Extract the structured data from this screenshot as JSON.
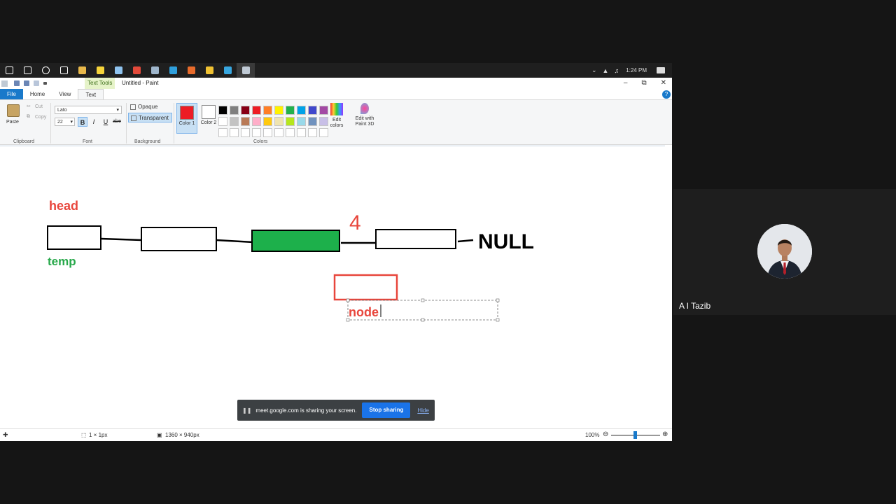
{
  "taskbar": {
    "icons": [
      {
        "name": "start-icon",
        "color": "#ffffff"
      },
      {
        "name": "search-icon",
        "color": "#ffffff"
      },
      {
        "name": "cortana-icon",
        "color": "#ffffff"
      },
      {
        "name": "task-view-icon",
        "color": "#ffffff"
      },
      {
        "name": "file-explorer-icon",
        "color": "#e8b84a"
      },
      {
        "name": "sticky-notes-icon",
        "color": "#f6d43a"
      },
      {
        "name": "notepad-icon",
        "color": "#8fc3ef"
      },
      {
        "name": "chrome-icon",
        "color": "#e3493a"
      },
      {
        "name": "document-icon",
        "color": "#9fb6cc"
      },
      {
        "name": "edge-icon",
        "color": "#2f9fdc"
      },
      {
        "name": "office-icon",
        "color": "#e86b2b"
      },
      {
        "name": "chrome-2-icon",
        "color": "#f1c232"
      },
      {
        "name": "edge-2-icon",
        "color": "#38a7e0"
      },
      {
        "name": "paint-icon",
        "color": "#bfc9d4"
      }
    ],
    "clock": "1:24 PM"
  },
  "titlebar": {
    "context_tab": "Text Tools",
    "title": "Untitled - Paint"
  },
  "tabs": {
    "file": "File",
    "home": "Home",
    "view": "View",
    "text": "Text"
  },
  "ribbon": {
    "clipboard": {
      "paste": "Paste",
      "cut": "Cut",
      "copy": "Copy",
      "label": "Clipboard"
    },
    "font": {
      "family": "Lato",
      "size": "22",
      "bold": "B",
      "italic": "I",
      "underline": "U",
      "strike": "abe",
      "label": "Font"
    },
    "background": {
      "opaque": "Opaque",
      "transparent": "Transparent",
      "label": "Background"
    },
    "color1": {
      "label": "Color 1",
      "value": "#ed1c24"
    },
    "color2": {
      "label": "Color 2",
      "value": "#ffffff"
    },
    "colors_label": "Colors",
    "edit_colors": "Edit colors",
    "edit_paint3d": "Edit with Paint 3D",
    "palette": [
      "#000000",
      "#7f7f7f",
      "#880015",
      "#ed1c24",
      "#ff7f27",
      "#fff200",
      "#22b14c",
      "#00a2e8",
      "#3f48cc",
      "#a349a4",
      "#ffffff",
      "#c3c3c3",
      "#b97a57",
      "#ffaec9",
      "#ffc90e",
      "#efe4b0",
      "#b5e61d",
      "#99d9ea",
      "#7092be",
      "#c8bfe7",
      "#ffffff",
      "#ffffff",
      "#ffffff",
      "#ffffff",
      "#ffffff",
      "#ffffff",
      "#ffffff",
      "#ffffff",
      "#ffffff",
      "#ffffff"
    ]
  },
  "drawing": {
    "head_label": "head",
    "temp_label": "temp",
    "index_label": "4",
    "null_label": "NULL",
    "node_text": "node",
    "head_color": "#e8463c",
    "temp_color": "#27a84a",
    "fill_green": "#1db04b",
    "new_node_color": "#e8463c"
  },
  "status": {
    "selection": "1 × 1px",
    "canvas_size": "1360 × 940px",
    "zoom": "100%"
  },
  "share_banner": {
    "message": "meet.google.com is sharing your screen.",
    "stop": "Stop sharing",
    "hide": "Hide"
  },
  "participant": {
    "name": "A I Tazib"
  }
}
